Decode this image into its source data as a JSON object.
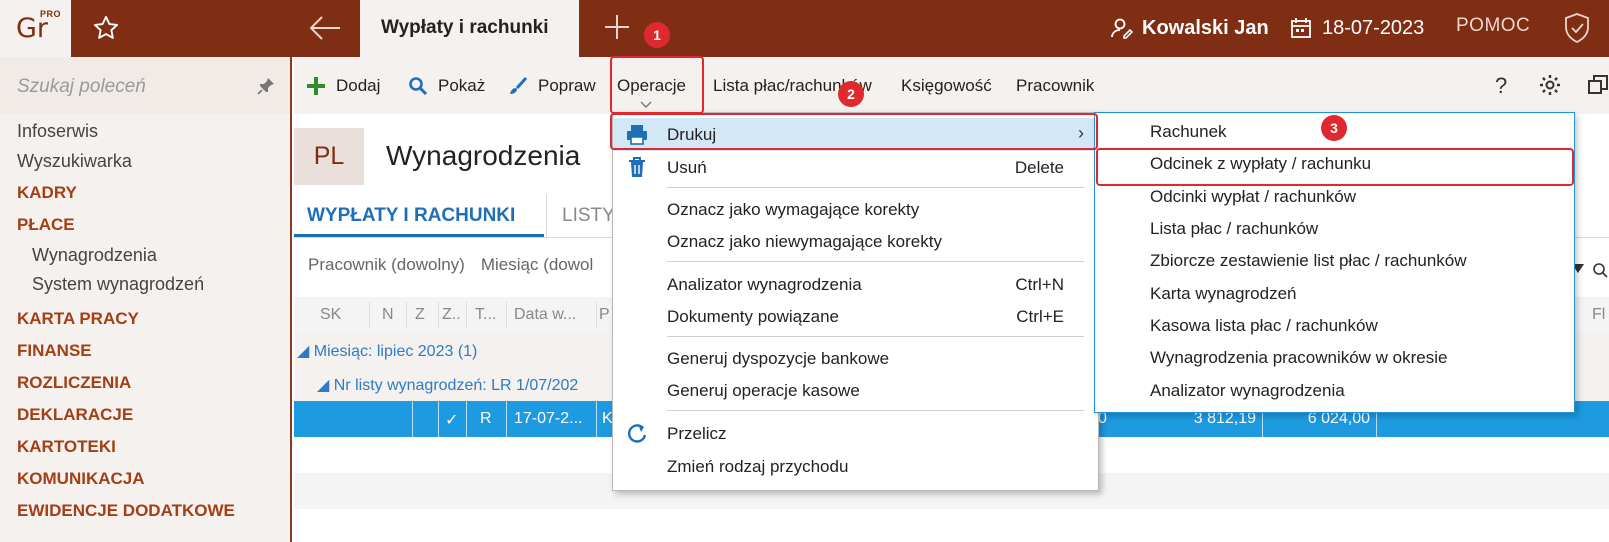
{
  "app": {
    "logo_text": "Gr",
    "logo_badge": "PRO",
    "active_tab": "Wypłaty i rachunki",
    "user": "Kowalski Jan",
    "date": "18-07-2023",
    "help": "POMOC"
  },
  "sidebar": {
    "search_placeholder": "Szukaj poleceń",
    "items": [
      {
        "label": "Infoserwis",
        "kind": "plain"
      },
      {
        "label": "Wyszukiwarka",
        "kind": "plain"
      },
      {
        "label": "KADRY",
        "kind": "category"
      },
      {
        "label": "PŁACE",
        "kind": "category"
      },
      {
        "label": "Wynagrodzenia",
        "kind": "sub"
      },
      {
        "label": "System wynagrodzeń",
        "kind": "sub"
      },
      {
        "label": "KARTA PRACY",
        "kind": "category"
      },
      {
        "label": "FINANSE",
        "kind": "category"
      },
      {
        "label": "ROZLICZENIA",
        "kind": "category"
      },
      {
        "label": "DEKLARACJE",
        "kind": "category"
      },
      {
        "label": "KARTOTEKI",
        "kind": "category"
      },
      {
        "label": "KOMUNIKACJA",
        "kind": "category"
      },
      {
        "label": "EWIDENCJE DODATKOWE",
        "kind": "category"
      }
    ]
  },
  "toolbar": {
    "add": "Dodaj",
    "show": "Pokaż",
    "edit": "Popraw",
    "operations": "Operacje",
    "payroll": "Lista płac/rachunków",
    "accounting": "Księgowość",
    "employee": "Pracownik",
    "help_glyph": "?"
  },
  "main": {
    "badge": "PL",
    "title": "Wynagrodzenia",
    "tab_active": "WYPŁATY I RACHUNKI",
    "tab_other": "LISTY",
    "filter_employee": "Pracownik (dowolny)",
    "filter_month": "Miesiąc (dowol",
    "columns": [
      "SK",
      "N",
      "Z",
      "Z..",
      "T...",
      "Data w...",
      "P",
      "Fl"
    ],
    "group_month": "Miesiąc: lipiec 2023 (1)",
    "group_list": "Nr listy wynagrodzeń: LR 1/07/202",
    "selected_row": {
      "check": "✓",
      "type": "R",
      "date": "17-07-2...",
      "p": "K",
      "col_hidden": "0",
      "amount1": "3 812,19",
      "amount2": "6 024,00"
    }
  },
  "menu": {
    "items": [
      {
        "label": "Drukuj",
        "shortcut": "",
        "icon": "printer-icon",
        "submenu": true
      },
      {
        "label": "Usuń",
        "shortcut": "Delete",
        "icon": "trash-icon"
      },
      {
        "label": "Oznacz jako wymagające korekty",
        "shortcut": ""
      },
      {
        "label": "Oznacz jako niewymagające korekty",
        "shortcut": ""
      },
      {
        "label": "Analizator wynagrodzenia",
        "shortcut": "Ctrl+N"
      },
      {
        "label": "Dokumenty powiązane",
        "shortcut": "Ctrl+E"
      },
      {
        "label": "Generuj dyspozycje bankowe",
        "shortcut": ""
      },
      {
        "label": "Generuj operacje kasowe",
        "shortcut": ""
      },
      {
        "label": "Przelicz",
        "shortcut": "",
        "icon": "refresh-icon"
      },
      {
        "label": "Zmień rodzaj przychodu",
        "shortcut": ""
      }
    ],
    "arrow": "›"
  },
  "submenu": {
    "items": [
      "Rachunek",
      "Odcinek z wypłaty / rachunku",
      "Odcinki wypłat / rachunków",
      "Lista płac / rachunków",
      "Zbiorcze zestawienie list płac / rachunków",
      "Karta wynagrodzeń",
      "Kasowa lista płac / rachunków",
      "Wynagrodzenia pracowników w okresie",
      "Analizator wynagrodzenia"
    ]
  },
  "annotations": {
    "step1": "1",
    "step2": "2",
    "step3": "3"
  },
  "colors": {
    "brand": "#7f2d13",
    "category": "#a33f17",
    "accent_blue": "#1f6fb8",
    "selection": "#1d9ae0",
    "annotation_red": "#e0282f"
  }
}
